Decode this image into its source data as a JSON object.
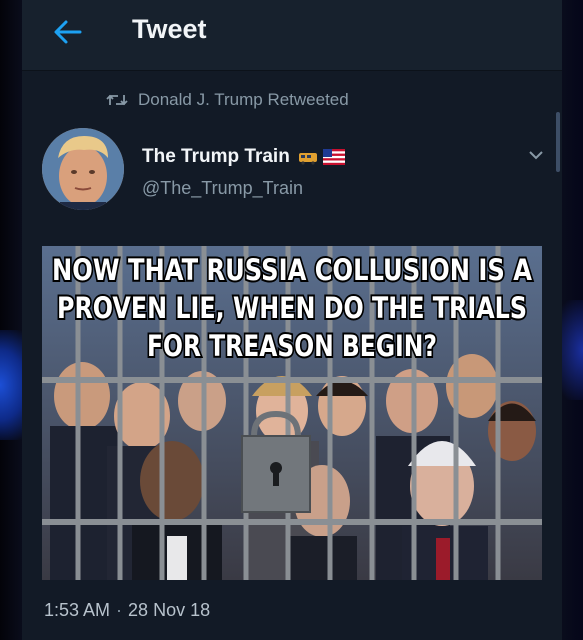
{
  "header": {
    "title": "Tweet",
    "back_icon": "arrow-left-icon"
  },
  "retweet": {
    "icon": "retweet-icon",
    "text": "Donald J. Trump Retweeted"
  },
  "author": {
    "name": "The Trump Train",
    "emoji": [
      "train-emoji",
      "us-flag-emoji"
    ],
    "handle": "@The_Trump_Train"
  },
  "tweet": {
    "meme_text": {
      "line1": "NOW THAT RUSSIA COLLUSION IS A",
      "line2": "PROVEN LIE, WHEN DO THE TRIALS",
      "line3": "FOR TREASON BEGIN?"
    },
    "time": "1:53 AM",
    "separator": "·",
    "date": "28 Nov 18"
  },
  "colors": {
    "accent": "#1da1f2",
    "background": "#121a26",
    "secondary_text": "#8899a6"
  }
}
